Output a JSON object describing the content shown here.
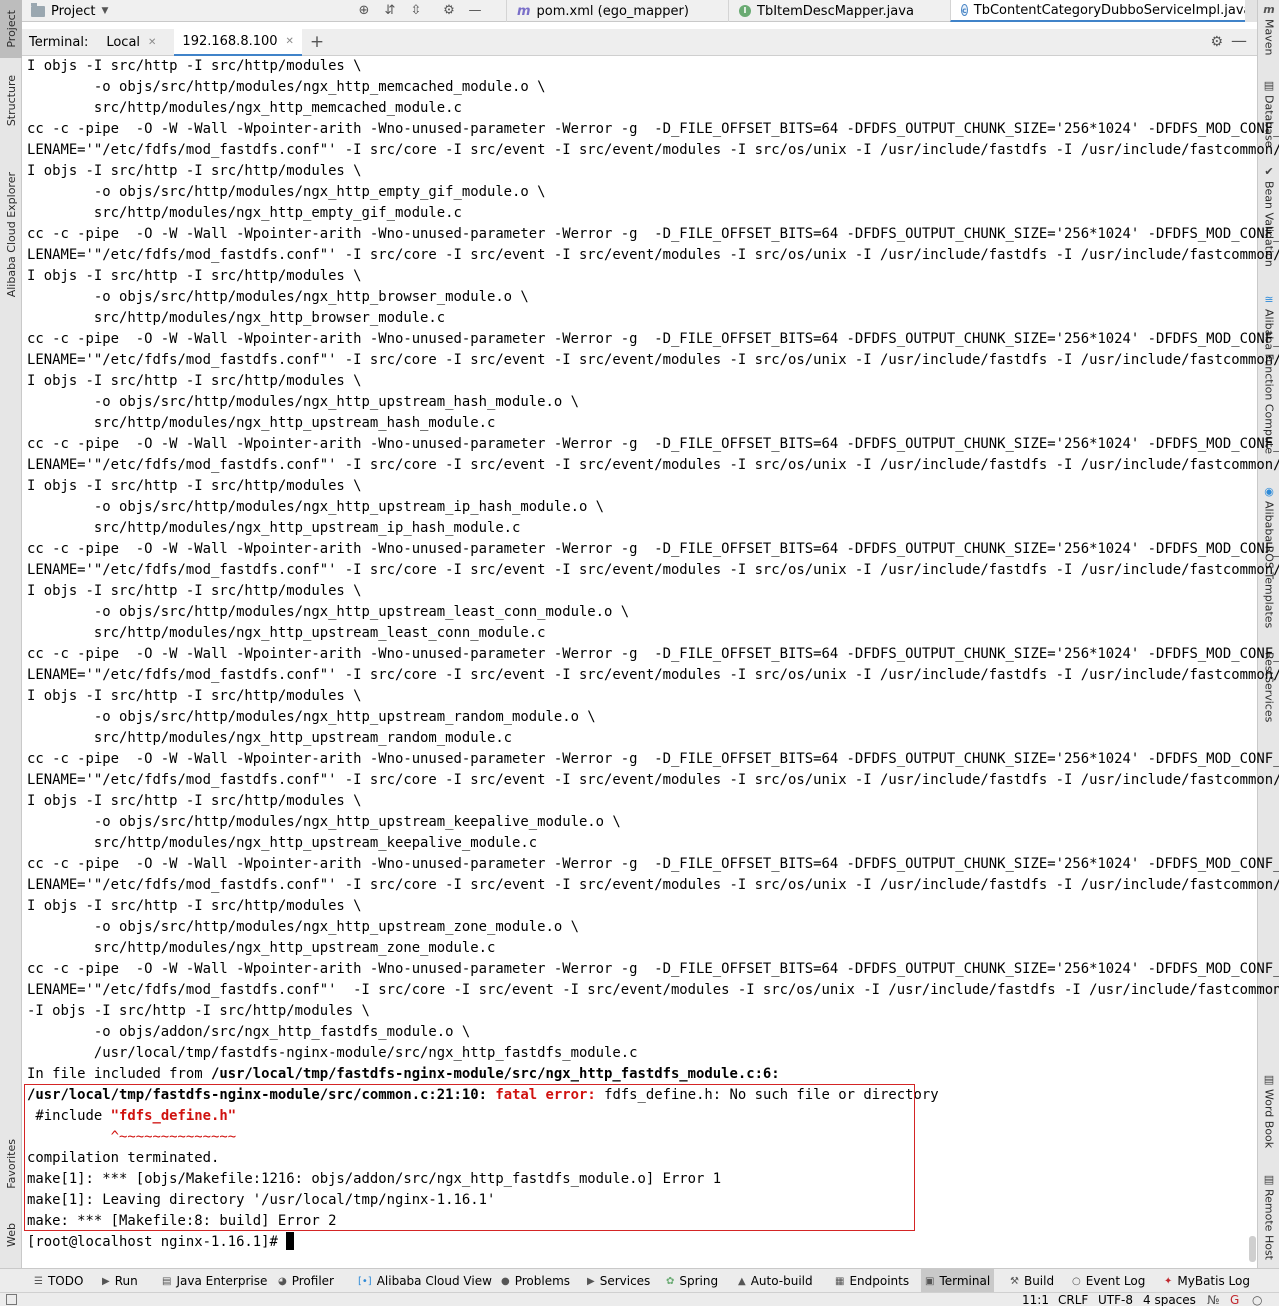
{
  "left_strip": {
    "tabs": [
      "Project",
      "Structure",
      "Alibaba Cloud Explorer",
      "Favorites",
      "Web"
    ]
  },
  "right_strip": {
    "tabs": [
      "Maven",
      "Database",
      "Bean Validation",
      "Alibaba Function Compute",
      "Alibaba ROS Templates",
      "RestServices",
      "Word Book",
      "Remote Host"
    ]
  },
  "project_panel": {
    "title": "Project"
  },
  "editor_tabs": [
    {
      "label": "pom.xml (ego_mapper)",
      "icon": "maven-file-icon"
    },
    {
      "label": "TbItemDescMapper.java",
      "icon": "interface-icon"
    },
    {
      "label": "TbContentCategoryDubboServiceImpl.java",
      "icon": "class-icon",
      "active": true
    }
  ],
  "terminal": {
    "label": "Terminal:",
    "tabs": [
      {
        "label": "Local"
      },
      {
        "label": "192.168.8.100",
        "active": true
      }
    ],
    "lines": [
      "I objs -I src/http -I src/http/modules \\",
      "        -o objs/src/http/modules/ngx_http_memcached_module.o \\",
      "        src/http/modules/ngx_http_memcached_module.c",
      "cc -c -pipe  -O -W -Wall -Wpointer-arith -Wno-unused-parameter -Werror -g  -D_FILE_OFFSET_BITS=64 -DFDFS_OUTPUT_CHUNK_SIZE='256*1024' -DFDFS_MOD_CONF_FI",
      "LENAME='\"/etc/fdfs/mod_fastdfs.conf\"' -I src/core -I src/event -I src/event/modules -I src/os/unix -I /usr/include/fastdfs -I /usr/include/fastcommon/ -",
      "I objs -I src/http -I src/http/modules \\",
      "        -o objs/src/http/modules/ngx_http_empty_gif_module.o \\",
      "        src/http/modules/ngx_http_empty_gif_module.c",
      "cc -c -pipe  -O -W -Wall -Wpointer-arith -Wno-unused-parameter -Werror -g  -D_FILE_OFFSET_BITS=64 -DFDFS_OUTPUT_CHUNK_SIZE='256*1024' -DFDFS_MOD_CONF_FI",
      "LENAME='\"/etc/fdfs/mod_fastdfs.conf\"' -I src/core -I src/event -I src/event/modules -I src/os/unix -I /usr/include/fastdfs -I /usr/include/fastcommon/ -",
      "I objs -I src/http -I src/http/modules \\",
      "        -o objs/src/http/modules/ngx_http_browser_module.o \\",
      "        src/http/modules/ngx_http_browser_module.c",
      "cc -c -pipe  -O -W -Wall -Wpointer-arith -Wno-unused-parameter -Werror -g  -D_FILE_OFFSET_BITS=64 -DFDFS_OUTPUT_CHUNK_SIZE='256*1024' -DFDFS_MOD_CONF_FI",
      "LENAME='\"/etc/fdfs/mod_fastdfs.conf\"' -I src/core -I src/event -I src/event/modules -I src/os/unix -I /usr/include/fastdfs -I /usr/include/fastcommon/ -",
      "I objs -I src/http -I src/http/modules \\",
      "        -o objs/src/http/modules/ngx_http_upstream_hash_module.o \\",
      "        src/http/modules/ngx_http_upstream_hash_module.c",
      "cc -c -pipe  -O -W -Wall -Wpointer-arith -Wno-unused-parameter -Werror -g  -D_FILE_OFFSET_BITS=64 -DFDFS_OUTPUT_CHUNK_SIZE='256*1024' -DFDFS_MOD_CONF_FI",
      "LENAME='\"/etc/fdfs/mod_fastdfs.conf\"' -I src/core -I src/event -I src/event/modules -I src/os/unix -I /usr/include/fastdfs -I /usr/include/fastcommon/ -",
      "I objs -I src/http -I src/http/modules \\",
      "        -o objs/src/http/modules/ngx_http_upstream_ip_hash_module.o \\",
      "        src/http/modules/ngx_http_upstream_ip_hash_module.c",
      "cc -c -pipe  -O -W -Wall -Wpointer-arith -Wno-unused-parameter -Werror -g  -D_FILE_OFFSET_BITS=64 -DFDFS_OUTPUT_CHUNK_SIZE='256*1024' -DFDFS_MOD_CONF_FI",
      "LENAME='\"/etc/fdfs/mod_fastdfs.conf\"' -I src/core -I src/event -I src/event/modules -I src/os/unix -I /usr/include/fastdfs -I /usr/include/fastcommon/ -",
      "I objs -I src/http -I src/http/modules \\",
      "        -o objs/src/http/modules/ngx_http_upstream_least_conn_module.o \\",
      "        src/http/modules/ngx_http_upstream_least_conn_module.c",
      "cc -c -pipe  -O -W -Wall -Wpointer-arith -Wno-unused-parameter -Werror -g  -D_FILE_OFFSET_BITS=64 -DFDFS_OUTPUT_CHUNK_SIZE='256*1024' -DFDFS_MOD_CONF_FI",
      "LENAME='\"/etc/fdfs/mod_fastdfs.conf\"' -I src/core -I src/event -I src/event/modules -I src/os/unix -I /usr/include/fastdfs -I /usr/include/fastcommon/ -",
      "I objs -I src/http -I src/http/modules \\",
      "        -o objs/src/http/modules/ngx_http_upstream_random_module.o \\",
      "        src/http/modules/ngx_http_upstream_random_module.c",
      "cc -c -pipe  -O -W -Wall -Wpointer-arith -Wno-unused-parameter -Werror -g  -D_FILE_OFFSET_BITS=64 -DFDFS_OUTPUT_CHUNK_SIZE='256*1024' -DFDFS_MOD_CONF_FI",
      "LENAME='\"/etc/fdfs/mod_fastdfs.conf\"' -I src/core -I src/event -I src/event/modules -I src/os/unix -I /usr/include/fastdfs -I /usr/include/fastcommon/ -",
      "I objs -I src/http -I src/http/modules \\",
      "        -o objs/src/http/modules/ngx_http_upstream_keepalive_module.o \\",
      "        src/http/modules/ngx_http_upstream_keepalive_module.c",
      "cc -c -pipe  -O -W -Wall -Wpointer-arith -Wno-unused-parameter -Werror -g  -D_FILE_OFFSET_BITS=64 -DFDFS_OUTPUT_CHUNK_SIZE='256*1024' -DFDFS_MOD_CONF_FI",
      "LENAME='\"/etc/fdfs/mod_fastdfs.conf\"' -I src/core -I src/event -I src/event/modules -I src/os/unix -I /usr/include/fastdfs -I /usr/include/fastcommon/ -",
      "I objs -I src/http -I src/http/modules \\",
      "        -o objs/src/http/modules/ngx_http_upstream_zone_module.o \\",
      "        src/http/modules/ngx_http_upstream_zone_module.c",
      "cc -c -pipe  -O -W -Wall -Wpointer-arith -Wno-unused-parameter -Werror -g  -D_FILE_OFFSET_BITS=64 -DFDFS_OUTPUT_CHUNK_SIZE='256*1024' -DFDFS_MOD_CONF_FI",
      "LENAME='\"/etc/fdfs/mod_fastdfs.conf\"'  -I src/core -I src/event -I src/event/modules -I src/os/unix -I /usr/include/fastdfs -I /usr/include/fastcommon/",
      "-I objs -I src/http -I src/http/modules \\",
      "        -o objs/addon/src/ngx_http_fastdfs_module.o \\",
      "        /usr/local/tmp/fastdfs-nginx-module/src/ngx_http_fastdfs_module.c"
    ],
    "included_from": {
      "prefix": "In file included from ",
      "path": "/usr/local/tmp/fastdfs-nginx-module/src/ngx_http_fastdfs_module.c:6:"
    },
    "error_line": {
      "location": "/usr/local/tmp/fastdfs-nginx-module/src/common.c:21:10:",
      "kind": "fatal error:",
      "message": "fdfs_define.h: No such file or directory"
    },
    "include_line": {
      "directive": " #include ",
      "target": "\"fdfs_define.h\""
    },
    "caret_line": "          ^~~~~~~~~~~~~~~",
    "tail_lines": [
      "compilation terminated.",
      "make[1]: *** [objs/Makefile:1216: objs/addon/src/ngx_http_fastdfs_module.o] Error 1",
      "make[1]: Leaving directory '/usr/local/tmp/nginx-1.16.1'",
      "make: *** [Makefile:8: build] Error 2"
    ],
    "prompt": "[root@localhost nginx-1.16.1]# "
  },
  "bottom_tools": [
    {
      "label": "TODO"
    },
    {
      "label": "Run"
    },
    {
      "label": "Java Enterprise"
    },
    {
      "label": "Profiler"
    },
    {
      "label": "Alibaba Cloud View"
    },
    {
      "label": "Problems"
    },
    {
      "label": "Services"
    },
    {
      "label": "Spring"
    },
    {
      "label": "Auto-build"
    },
    {
      "label": "Endpoints"
    },
    {
      "label": "Terminal",
      "active": true
    },
    {
      "label": "Build"
    },
    {
      "label": "Event Log"
    },
    {
      "label": "MyBatis Log"
    }
  ],
  "status": {
    "position": "11:1",
    "line_separator": "CRLF",
    "encoding": "UTF-8",
    "indent": "4 spaces"
  },
  "colors": {
    "error_red": "#d0120f",
    "accent_blue": "#4083c9"
  }
}
